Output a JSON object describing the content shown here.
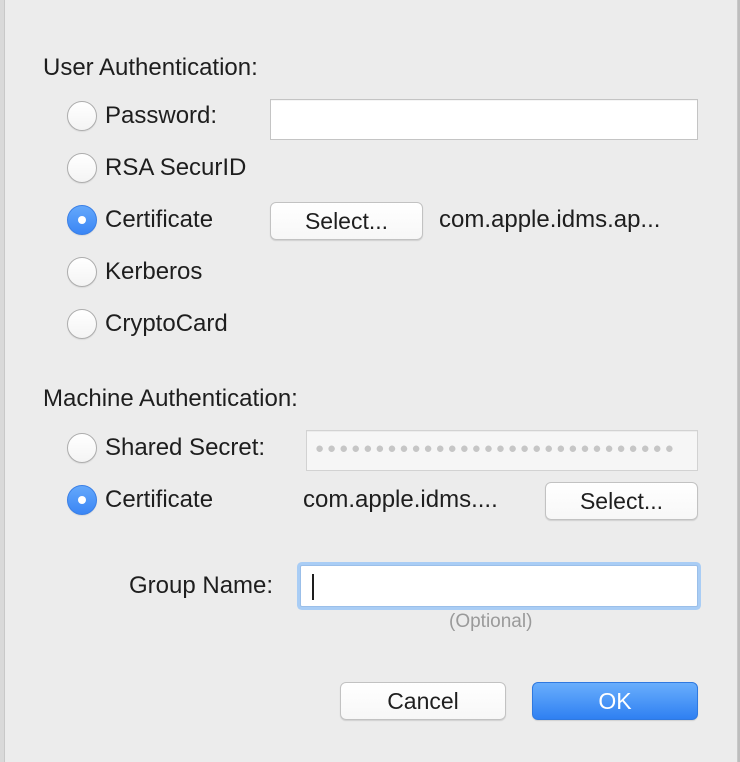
{
  "user_auth": {
    "title": "User Authentication:",
    "options": [
      {
        "label": "Password:",
        "selected": false
      },
      {
        "label": "RSA SecurID",
        "selected": false
      },
      {
        "label": "Certificate",
        "selected": true
      },
      {
        "label": "Kerberos",
        "selected": false
      },
      {
        "label": "CryptoCard",
        "selected": false
      }
    ],
    "password_value": "",
    "select_label": "Select...",
    "certificate_name": "com.apple.idms.ap..."
  },
  "machine_auth": {
    "title": "Machine Authentication:",
    "options": [
      {
        "label": "Shared Secret:",
        "selected": false
      },
      {
        "label": "Certificate",
        "selected": true
      }
    ],
    "shared_secret_mask": "●●●●●●●●●●●●●●●●●●●●●●●●●●●●●●",
    "certificate_name": "com.apple.idms....",
    "select_label": "Select..."
  },
  "group": {
    "label": "Group Name:",
    "value": "",
    "hint": "(Optional)"
  },
  "footer": {
    "cancel_label": "Cancel",
    "ok_label": "OK"
  },
  "colors": {
    "accent": "#3b86f5",
    "background": "#ececec"
  }
}
